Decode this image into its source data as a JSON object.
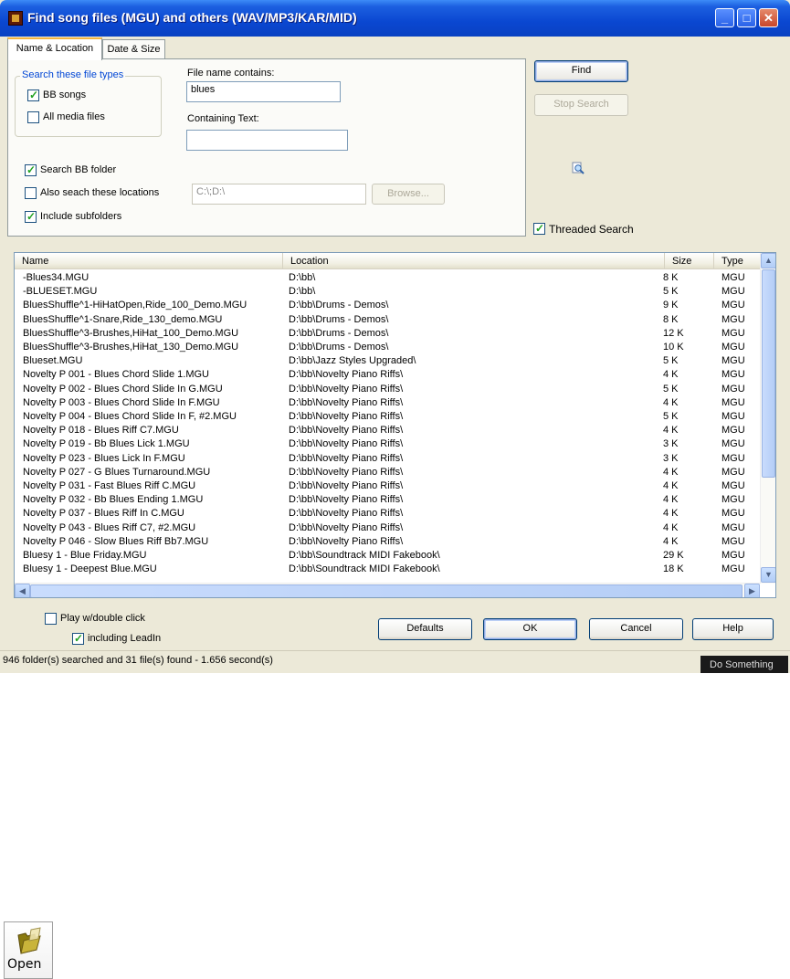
{
  "window": {
    "title": "Find song files (MGU) and others (WAV/MP3/KAR/MID)"
  },
  "tabs": [
    "Name & Location",
    "Date & Size"
  ],
  "group": {
    "title": "Search these file types",
    "bb_songs": {
      "label": "BB songs",
      "checked": true
    },
    "all_media": {
      "label": "All media files",
      "checked": false
    }
  },
  "filename": {
    "label": "File name contains:",
    "value": "blues"
  },
  "containing": {
    "label": "Containing Text:",
    "value": ""
  },
  "search_bb_folder": {
    "label": "Search BB folder",
    "checked": true
  },
  "also_search": {
    "label": "Also seach these locations",
    "checked": false,
    "value": "C:\\;D:\\"
  },
  "include_sub": {
    "label": "Include subfolders",
    "checked": true
  },
  "buttons": {
    "find": "Find",
    "stop": "Stop Search",
    "browse": "Browse...",
    "defaults": "Defaults",
    "ok": "OK",
    "cancel": "Cancel",
    "help": "Help"
  },
  "threaded": {
    "label": "Threaded Search",
    "checked": true
  },
  "columns": [
    "Name",
    "Location",
    "Size",
    "Type"
  ],
  "rows": [
    [
      "-Blues34.MGU",
      "D:\\bb\\",
      "8 K",
      "MGU"
    ],
    [
      "-BLUESET.MGU",
      "D:\\bb\\",
      "5 K",
      "MGU"
    ],
    [
      "BluesShuffle^1-HiHatOpen,Ride_100_Demo.MGU",
      "D:\\bb\\Drums - Demos\\",
      "9 K",
      "MGU"
    ],
    [
      "BluesShuffle^1-Snare,Ride_130_demo.MGU",
      "D:\\bb\\Drums - Demos\\",
      "8 K",
      "MGU"
    ],
    [
      "BluesShuffle^3-Brushes,HiHat_100_Demo.MGU",
      "D:\\bb\\Drums - Demos\\",
      "12 K",
      "MGU"
    ],
    [
      "BluesShuffle^3-Brushes,HiHat_130_Demo.MGU",
      "D:\\bb\\Drums - Demos\\",
      "10 K",
      "MGU"
    ],
    [
      "Blueset.MGU",
      "D:\\bb\\Jazz Styles Upgraded\\",
      "5 K",
      "MGU"
    ],
    [
      "Novelty P 001 - Blues Chord Slide 1.MGU",
      "D:\\bb\\Novelty Piano Riffs\\",
      "4 K",
      "MGU"
    ],
    [
      "Novelty P 002 - Blues Chord Slide In G.MGU",
      "D:\\bb\\Novelty Piano Riffs\\",
      "5 K",
      "MGU"
    ],
    [
      "Novelty P 003 - Blues Chord Slide In F.MGU",
      "D:\\bb\\Novelty Piano Riffs\\",
      "4 K",
      "MGU"
    ],
    [
      "Novelty P 004 - Blues Chord Slide In F, #2.MGU",
      "D:\\bb\\Novelty Piano Riffs\\",
      "5 K",
      "MGU"
    ],
    [
      "Novelty P 018 - Blues Riff C7.MGU",
      "D:\\bb\\Novelty Piano Riffs\\",
      "4 K",
      "MGU"
    ],
    [
      "Novelty P 019 - Bb Blues Lick 1.MGU",
      "D:\\bb\\Novelty Piano Riffs\\",
      "3 K",
      "MGU"
    ],
    [
      "Novelty P 023 - Blues Lick In F.MGU",
      "D:\\bb\\Novelty Piano Riffs\\",
      "3 K",
      "MGU"
    ],
    [
      "Novelty P 027 - G Blues Turnaround.MGU",
      "D:\\bb\\Novelty Piano Riffs\\",
      "4 K",
      "MGU"
    ],
    [
      "Novelty P 031 - Fast Blues Riff C.MGU",
      "D:\\bb\\Novelty Piano Riffs\\",
      "4 K",
      "MGU"
    ],
    [
      "Novelty P 032 - Bb Blues Ending 1.MGU",
      "D:\\bb\\Novelty Piano Riffs\\",
      "4 K",
      "MGU"
    ],
    [
      "Novelty P 037 - Blues Riff In C.MGU",
      "D:\\bb\\Novelty Piano Riffs\\",
      "4 K",
      "MGU"
    ],
    [
      "Novelty P 043 - Blues Riff C7, #2.MGU",
      "D:\\bb\\Novelty Piano Riffs\\",
      "4 K",
      "MGU"
    ],
    [
      "Novelty P 046 - Slow Blues Riff Bb7.MGU",
      "D:\\bb\\Novelty Piano Riffs\\",
      "4 K",
      "MGU"
    ],
    [
      "Bluesy 1 - Blue Friday.MGU",
      "D:\\bb\\Soundtrack MIDI Fakebook\\",
      "29 K",
      "MGU"
    ],
    [
      "Bluesy 1 - Deepest Blue.MGU",
      "D:\\bb\\Soundtrack MIDI Fakebook\\",
      "18 K",
      "MGU"
    ]
  ],
  "play_dbl": {
    "label": "Play w/double click",
    "checked": false
  },
  "leadin": {
    "label": "including LeadIn",
    "checked": true
  },
  "status": "946 folder(s) searched and 31 file(s) found - 1.656 second(s)",
  "tooltip": "Do Something",
  "open_button": {
    "label": "Open"
  },
  "colors": {
    "title_bar": "#0a47d1",
    "window_bg": "#ece9d8",
    "group_title": "#0046d5",
    "check": "#21a121"
  },
  "icons": [
    "app-icon",
    "minimize-icon",
    "maximize-icon",
    "close-icon",
    "magnifier-icon",
    "folder-icon"
  ]
}
